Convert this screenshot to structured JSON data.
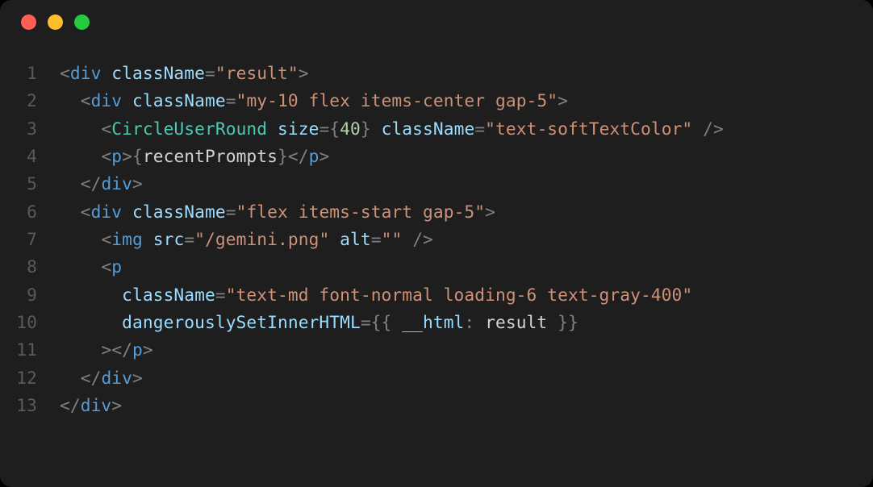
{
  "window": {
    "traffic_lights": {
      "close": "close",
      "minimize": "minimize",
      "maximize": "maximize"
    }
  },
  "editor": {
    "language": "jsx",
    "lines": [
      {
        "n": "1",
        "indent": "",
        "tokens": [
          {
            "c": "p",
            "t": "<"
          },
          {
            "c": "tg",
            "t": "div"
          },
          {
            "c": "id",
            "t": " "
          },
          {
            "c": "at",
            "t": "className"
          },
          {
            "c": "p",
            "t": "="
          },
          {
            "c": "st",
            "t": "\"result\""
          },
          {
            "c": "p",
            "t": ">"
          }
        ]
      },
      {
        "n": "2",
        "indent": "  ",
        "tokens": [
          {
            "c": "p",
            "t": "<"
          },
          {
            "c": "tg",
            "t": "div"
          },
          {
            "c": "id",
            "t": " "
          },
          {
            "c": "at",
            "t": "className"
          },
          {
            "c": "p",
            "t": "="
          },
          {
            "c": "st",
            "t": "\"my-10 flex items-center gap-5\""
          },
          {
            "c": "p",
            "t": ">"
          }
        ]
      },
      {
        "n": "3",
        "indent": "    ",
        "tokens": [
          {
            "c": "p",
            "t": "<"
          },
          {
            "c": "cmp",
            "t": "CircleUserRound"
          },
          {
            "c": "id",
            "t": " "
          },
          {
            "c": "at",
            "t": "size"
          },
          {
            "c": "p",
            "t": "={"
          },
          {
            "c": "nm",
            "t": "40"
          },
          {
            "c": "p",
            "t": "}"
          },
          {
            "c": "id",
            "t": " "
          },
          {
            "c": "at",
            "t": "className"
          },
          {
            "c": "p",
            "t": "="
          },
          {
            "c": "st",
            "t": "\"text-softTextColor\""
          },
          {
            "c": "id",
            "t": " "
          },
          {
            "c": "p",
            "t": "/>"
          }
        ]
      },
      {
        "n": "4",
        "indent": "    ",
        "tokens": [
          {
            "c": "p",
            "t": "<"
          },
          {
            "c": "tg",
            "t": "p"
          },
          {
            "c": "p",
            "t": ">{"
          },
          {
            "c": "jx",
            "t": "recentPrompts"
          },
          {
            "c": "p",
            "t": "}</"
          },
          {
            "c": "tg",
            "t": "p"
          },
          {
            "c": "p",
            "t": ">"
          }
        ]
      },
      {
        "n": "5",
        "indent": "  ",
        "tokens": [
          {
            "c": "p",
            "t": "</"
          },
          {
            "c": "tg",
            "t": "div"
          },
          {
            "c": "p",
            "t": ">"
          }
        ]
      },
      {
        "n": "6",
        "indent": "  ",
        "tokens": [
          {
            "c": "p",
            "t": "<"
          },
          {
            "c": "tg",
            "t": "div"
          },
          {
            "c": "id",
            "t": " "
          },
          {
            "c": "at",
            "t": "className"
          },
          {
            "c": "p",
            "t": "="
          },
          {
            "c": "st",
            "t": "\"flex items-start gap-5\""
          },
          {
            "c": "p",
            "t": ">"
          }
        ]
      },
      {
        "n": "7",
        "indent": "    ",
        "tokens": [
          {
            "c": "p",
            "t": "<"
          },
          {
            "c": "tg",
            "t": "img"
          },
          {
            "c": "id",
            "t": " "
          },
          {
            "c": "at",
            "t": "src"
          },
          {
            "c": "p",
            "t": "="
          },
          {
            "c": "st",
            "t": "\"/gemini.png\""
          },
          {
            "c": "id",
            "t": " "
          },
          {
            "c": "at",
            "t": "alt"
          },
          {
            "c": "p",
            "t": "="
          },
          {
            "c": "st",
            "t": "\"\""
          },
          {
            "c": "id",
            "t": " "
          },
          {
            "c": "p",
            "t": "/>"
          }
        ]
      },
      {
        "n": "8",
        "indent": "    ",
        "tokens": [
          {
            "c": "p",
            "t": "<"
          },
          {
            "c": "tg",
            "t": "p"
          }
        ]
      },
      {
        "n": "9",
        "indent": "      ",
        "tokens": [
          {
            "c": "at",
            "t": "className"
          },
          {
            "c": "p",
            "t": "="
          },
          {
            "c": "st",
            "t": "\"text-md font-normal loading-6 text-gray-400\""
          }
        ]
      },
      {
        "n": "10",
        "indent": "      ",
        "tokens": [
          {
            "c": "at",
            "t": "dangerouslySetInnerHTML"
          },
          {
            "c": "p",
            "t": "={{ "
          },
          {
            "c": "at",
            "t": "__html"
          },
          {
            "c": "p",
            "t": ": "
          },
          {
            "c": "jx",
            "t": "result"
          },
          {
            "c": "p",
            "t": " }}"
          }
        ]
      },
      {
        "n": "11",
        "indent": "    ",
        "tokens": [
          {
            "c": "p",
            "t": "></"
          },
          {
            "c": "tg",
            "t": "p"
          },
          {
            "c": "p",
            "t": ">"
          }
        ]
      },
      {
        "n": "12",
        "indent": "  ",
        "tokens": [
          {
            "c": "p",
            "t": "</"
          },
          {
            "c": "tg",
            "t": "div"
          },
          {
            "c": "p",
            "t": ">"
          }
        ]
      },
      {
        "n": "13",
        "indent": "",
        "tokens": [
          {
            "c": "p",
            "t": "</"
          },
          {
            "c": "tg",
            "t": "div"
          },
          {
            "c": "p",
            "t": ">"
          }
        ]
      }
    ]
  }
}
